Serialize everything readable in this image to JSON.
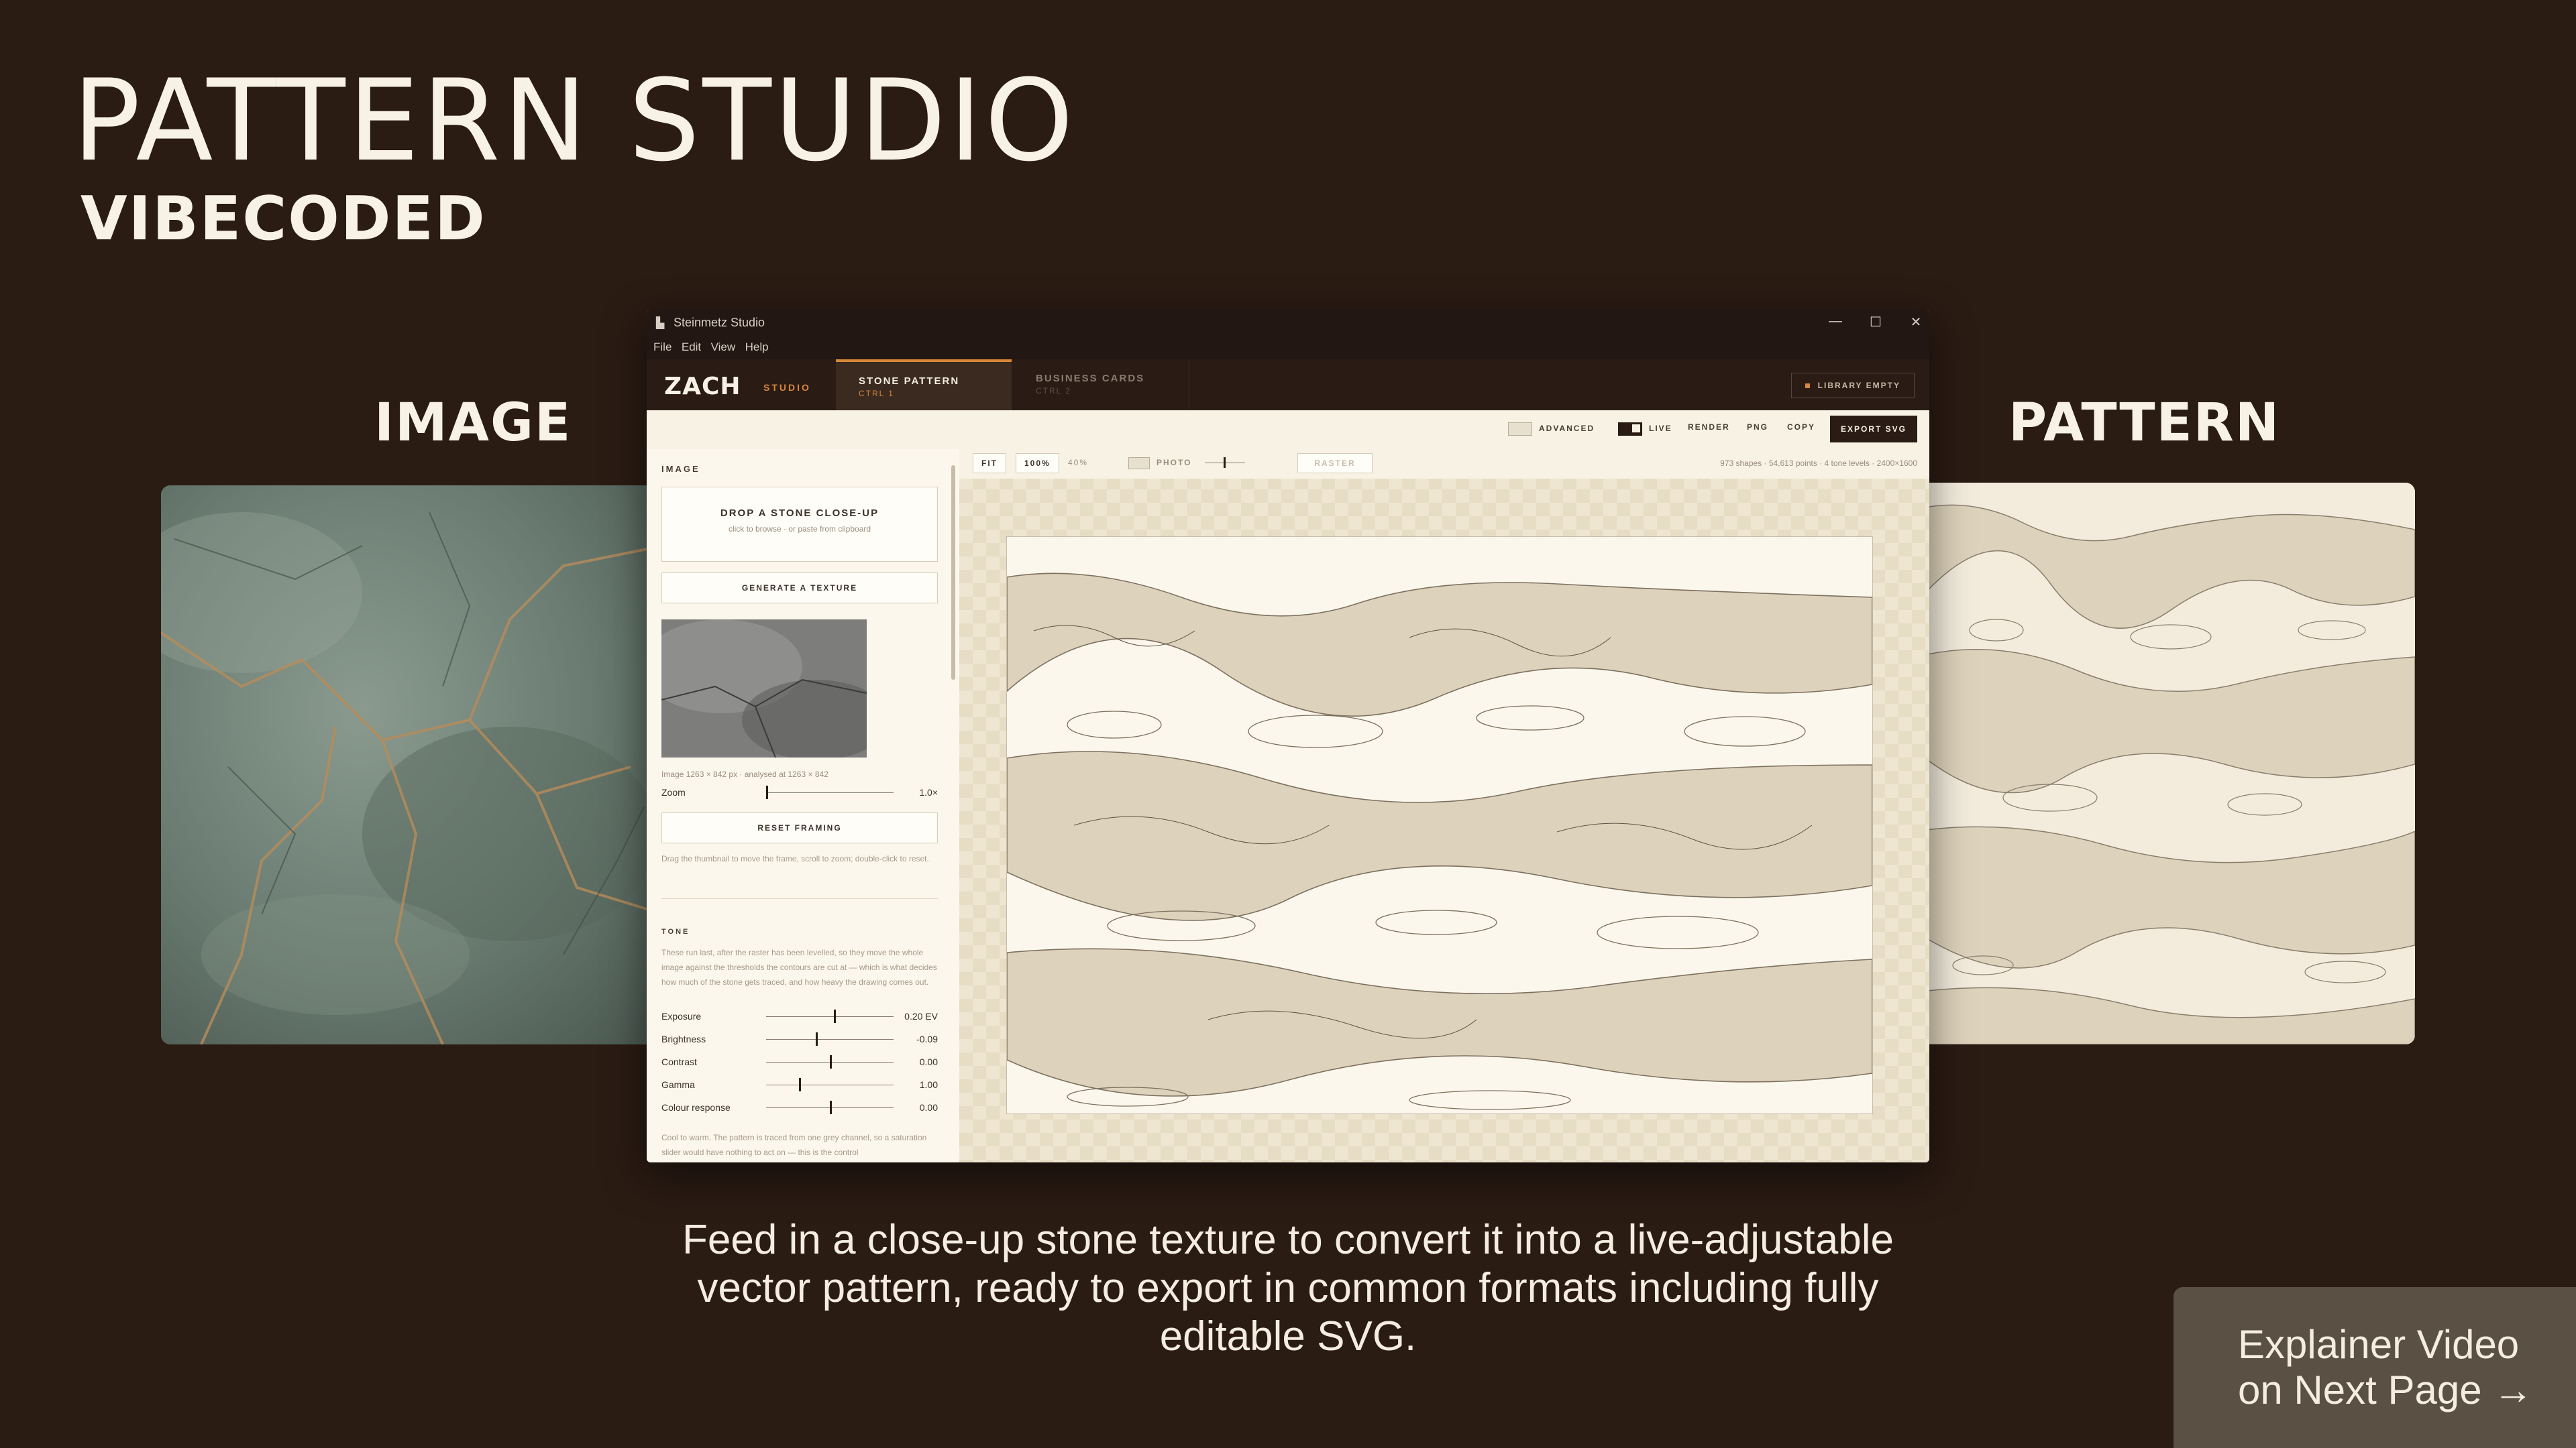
{
  "hero": {
    "title": "PATTERN STUDIO",
    "subtitle": "VIBECODED"
  },
  "labels": {
    "image": "IMAGE",
    "pattern": "PATTERN"
  },
  "caption": "Feed in a close-up stone texture to convert it into a live-adjustable vector pattern, ready to export in common formats including fully editable SVG.",
  "explainer": {
    "line1": "Explainer Video",
    "line2": "on Next Page →"
  },
  "app": {
    "window_title": "Steinmetz Studio",
    "window_controls": {
      "minimize": "—",
      "maximize": "☐",
      "close": "✕"
    },
    "menu": [
      "File",
      "Edit",
      "View",
      "Help"
    ],
    "brand": "ZACH",
    "brand_sub": "STUDIO",
    "tabs": [
      {
        "label": "STONE PATTERN",
        "shortcut": "CTRL 1"
      },
      {
        "label": "BUSINESS CARDS",
        "shortcut": "CTRL 2"
      }
    ],
    "library_badge": "LIBRARY EMPTY",
    "toolbar": {
      "advanced": "ADVANCED",
      "live": "LIVE",
      "render": "RENDER",
      "png": "PNG",
      "copy": "COPY",
      "export": "EXPORT SVG"
    },
    "canvas_bar": {
      "fit": "FIT",
      "zoom100": "100%",
      "zoom_level": "40%",
      "photo": "PHOTO",
      "raster": "RASTER",
      "stats": "973 shapes · 54,613 points · 4 tone levels · 2400×1600"
    },
    "panel": {
      "image_section": "IMAGE",
      "drop_title": "DROP A STONE CLOSE-UP",
      "drop_hint": "click to browse · or paste from clipboard",
      "generate_btn": "GENERATE A TEXTURE",
      "image_meta": "Image 1263 × 842 px · analysed at 1263 × 842",
      "zoom_label": "Zoom",
      "zoom_value": "1.0×",
      "reset_btn": "RESET FRAMING",
      "reset_help": "Drag the thumbnail to move the frame, scroll to zoom; double-click to reset.",
      "tone_section": "TONE",
      "tone_help": "These run last, after the raster has been levelled, so they move the whole image against the thresholds the contours are cut at — which is what decides how much of the stone gets traced, and how heavy the drawing comes out.",
      "sliders": [
        {
          "label": "Exposure",
          "value": "0.20 EV",
          "pos": 0.53
        },
        {
          "label": "Brightness",
          "value": "-0.09",
          "pos": 0.39
        },
        {
          "label": "Contrast",
          "value": "0.00",
          "pos": 0.5
        },
        {
          "label": "Gamma",
          "value": "1.00",
          "pos": 0.26
        },
        {
          "label": "Colour response",
          "value": "0.00",
          "pos": 0.5
        }
      ],
      "colour_help": "Cool to warm. The pattern is traced from one grey channel, so a saturation slider would have nothing to act on — this is the control"
    }
  }
}
